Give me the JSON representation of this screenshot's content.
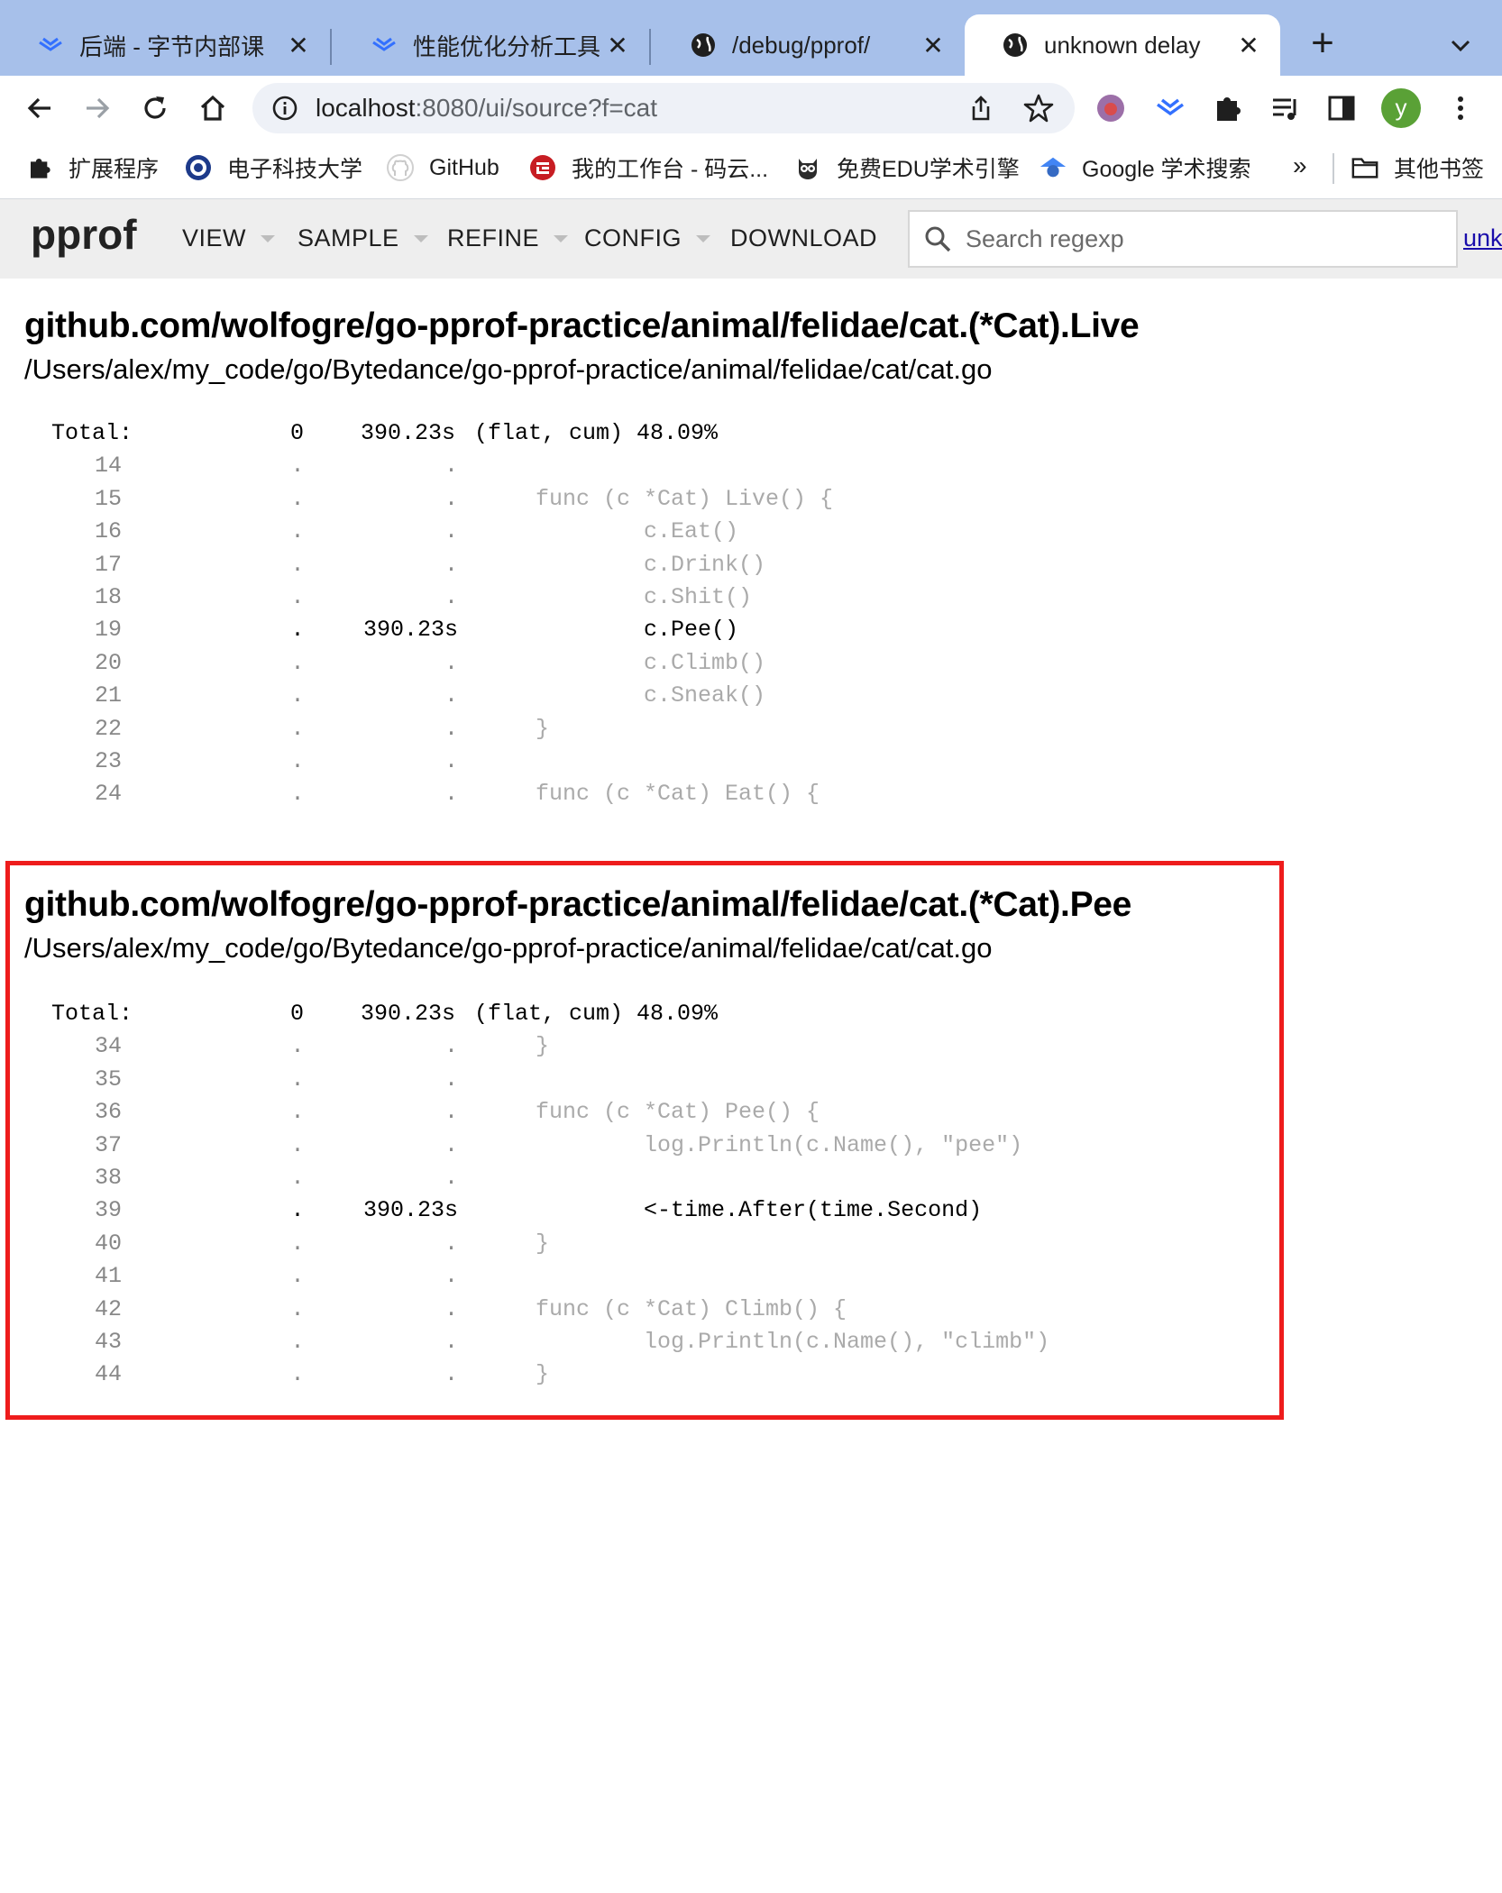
{
  "browser": {
    "tabs": [
      {
        "title": "后端 - 字节内部课",
        "icon": "lark-icon",
        "active": false
      },
      {
        "title": "性能优化分析工具 - 字",
        "icon": "lark-icon",
        "active": false
      },
      {
        "title": "/debug/pprof/",
        "icon": "globe-icon",
        "active": false
      },
      {
        "title": "unknown delay",
        "icon": "globe-icon",
        "active": true
      }
    ],
    "address": {
      "host": "localhost",
      "rest": ":8080/ui/source?f=cat"
    },
    "avatar_letter": "y",
    "bookmarks": [
      {
        "label": "扩展程序",
        "icon": "puzzle-icon"
      },
      {
        "label": "电子科技大学",
        "icon": "university-seal-icon"
      },
      {
        "label": "GitHub",
        "icon": "github-icon"
      },
      {
        "label": "我的工作台 - 码云...",
        "icon": "gitee-icon"
      },
      {
        "label": "免费EDU学术引擎",
        "icon": "owl-icon"
      },
      {
        "label": "Google 学术搜索",
        "icon": "scholar-icon"
      }
    ],
    "bookmarks_more": "»",
    "other_bookmarks": "其他书签"
  },
  "pprof": {
    "logo": "pprof",
    "menu": [
      "VIEW",
      "SAMPLE",
      "REFINE",
      "CONFIG",
      "DOWNLOAD"
    ],
    "search_placeholder": "Search regexp",
    "unknown_link": "unk"
  },
  "sections": [
    {
      "title": "github.com/wolfogre/go-pprof-practice/animal/felidae/cat.(*Cat).Live",
      "path": "/Users/alex/my_code/go/Bytedance/go-pprof-practice/animal/felidae/cat/cat.go",
      "total": {
        "label": "Total:",
        "flat": "0",
        "cum": "390.23s",
        "suffix": "(flat, cum) 48.09%"
      },
      "lines": [
        {
          "n": "14",
          "flat": ".",
          "cum": ".",
          "code": "",
          "hot": false
        },
        {
          "n": "15",
          "flat": ".",
          "cum": ".",
          "code": "func (c *Cat) Live() {",
          "hot": false
        },
        {
          "n": "16",
          "flat": ".",
          "cum": ".",
          "code": "        c.Eat()",
          "hot": false
        },
        {
          "n": "17",
          "flat": ".",
          "cum": ".",
          "code": "        c.Drink()",
          "hot": false
        },
        {
          "n": "18",
          "flat": ".",
          "cum": ".",
          "code": "        c.Shit()",
          "hot": false
        },
        {
          "n": "19",
          "flat": ".",
          "cum": "390.23s",
          "code": "        c.Pee()",
          "hot": true
        },
        {
          "n": "20",
          "flat": ".",
          "cum": ".",
          "code": "        c.Climb()",
          "hot": false
        },
        {
          "n": "21",
          "flat": ".",
          "cum": ".",
          "code": "        c.Sneak()",
          "hot": false
        },
        {
          "n": "22",
          "flat": ".",
          "cum": ".",
          "code": "}",
          "hot": false
        },
        {
          "n": "23",
          "flat": ".",
          "cum": ".",
          "code": "",
          "hot": false
        },
        {
          "n": "24",
          "flat": ".",
          "cum": ".",
          "code": "func (c *Cat) Eat() {",
          "hot": false
        }
      ]
    },
    {
      "title": "github.com/wolfogre/go-pprof-practice/animal/felidae/cat.(*Cat).Pee",
      "path": "/Users/alex/my_code/go/Bytedance/go-pprof-practice/animal/felidae/cat/cat.go",
      "total": {
        "label": "Total:",
        "flat": "0",
        "cum": "390.23s",
        "suffix": "(flat, cum) 48.09%"
      },
      "lines": [
        {
          "n": "34",
          "flat": ".",
          "cum": ".",
          "code": "}",
          "hot": false
        },
        {
          "n": "35",
          "flat": ".",
          "cum": ".",
          "code": "",
          "hot": false
        },
        {
          "n": "36",
          "flat": ".",
          "cum": ".",
          "code": "func (c *Cat) Pee() {",
          "hot": false
        },
        {
          "n": "37",
          "flat": ".",
          "cum": ".",
          "code": "        log.Println(c.Name(), \"pee\")",
          "hot": false
        },
        {
          "n": "38",
          "flat": ".",
          "cum": ".",
          "code": "",
          "hot": false
        },
        {
          "n": "39",
          "flat": ".",
          "cum": "390.23s",
          "code": "        <-time.After(time.Second)",
          "hot": true
        },
        {
          "n": "40",
          "flat": ".",
          "cum": ".",
          "code": "}",
          "hot": false
        },
        {
          "n": "41",
          "flat": ".",
          "cum": ".",
          "code": "",
          "hot": false
        },
        {
          "n": "42",
          "flat": ".",
          "cum": ".",
          "code": "func (c *Cat) Climb() {",
          "hot": false
        },
        {
          "n": "43",
          "flat": ".",
          "cum": ".",
          "code": "        log.Println(c.Name(), \"climb\")",
          "hot": false
        },
        {
          "n": "44",
          "flat": ".",
          "cum": ".",
          "code": "}",
          "hot": false
        }
      ]
    }
  ],
  "colors": {
    "highlight_border": "#ee1c1c",
    "tabstrip": "#a7c0ea",
    "pprof_header": "#eeeeee"
  }
}
